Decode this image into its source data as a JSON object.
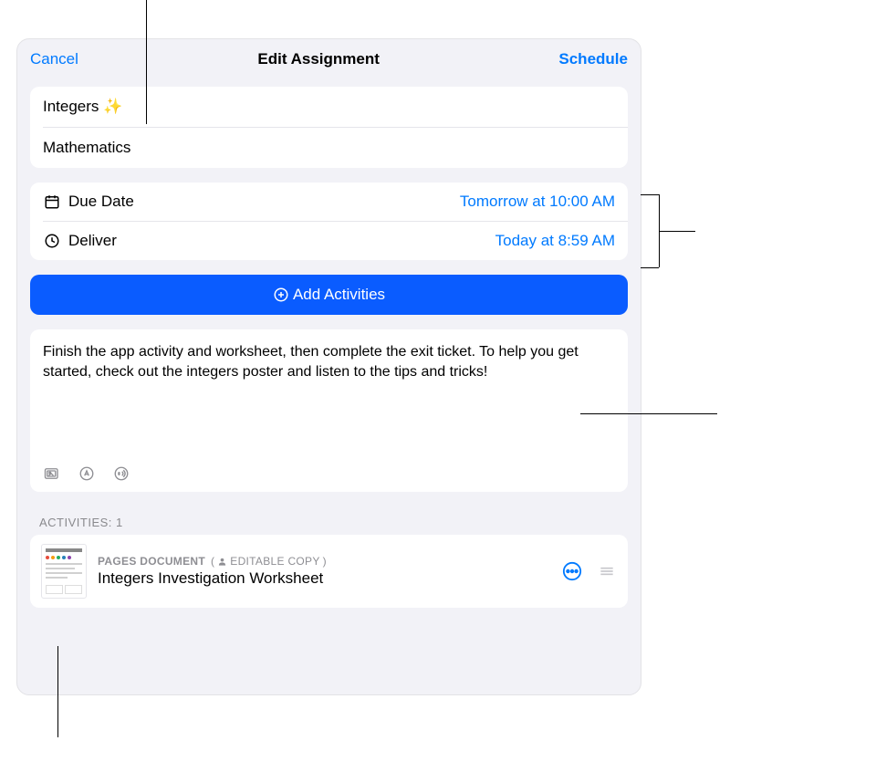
{
  "nav": {
    "cancel_label": "Cancel",
    "title": "Edit Assignment",
    "schedule_label": "Schedule"
  },
  "title_section": {
    "title": "Integers ✨",
    "subject": "Mathematics"
  },
  "details": {
    "due_date_label": "Due Date",
    "due_date_value": "Tomorrow at 10:00 AM",
    "deliver_label": "Deliver",
    "deliver_value": "Today at 8:59 AM"
  },
  "add_activities_label": "Add Activities",
  "instructions": "Finish the app activity and worksheet, then complete the exit ticket. To help you get started, check out the integers poster and listen to the tips and tricks!",
  "activities_header": "Activities: 1",
  "activity": {
    "doc_type": "PAGES DOCUMENT",
    "copy_type": "EDITABLE COPY",
    "title": "Integers Investigation Worksheet"
  }
}
